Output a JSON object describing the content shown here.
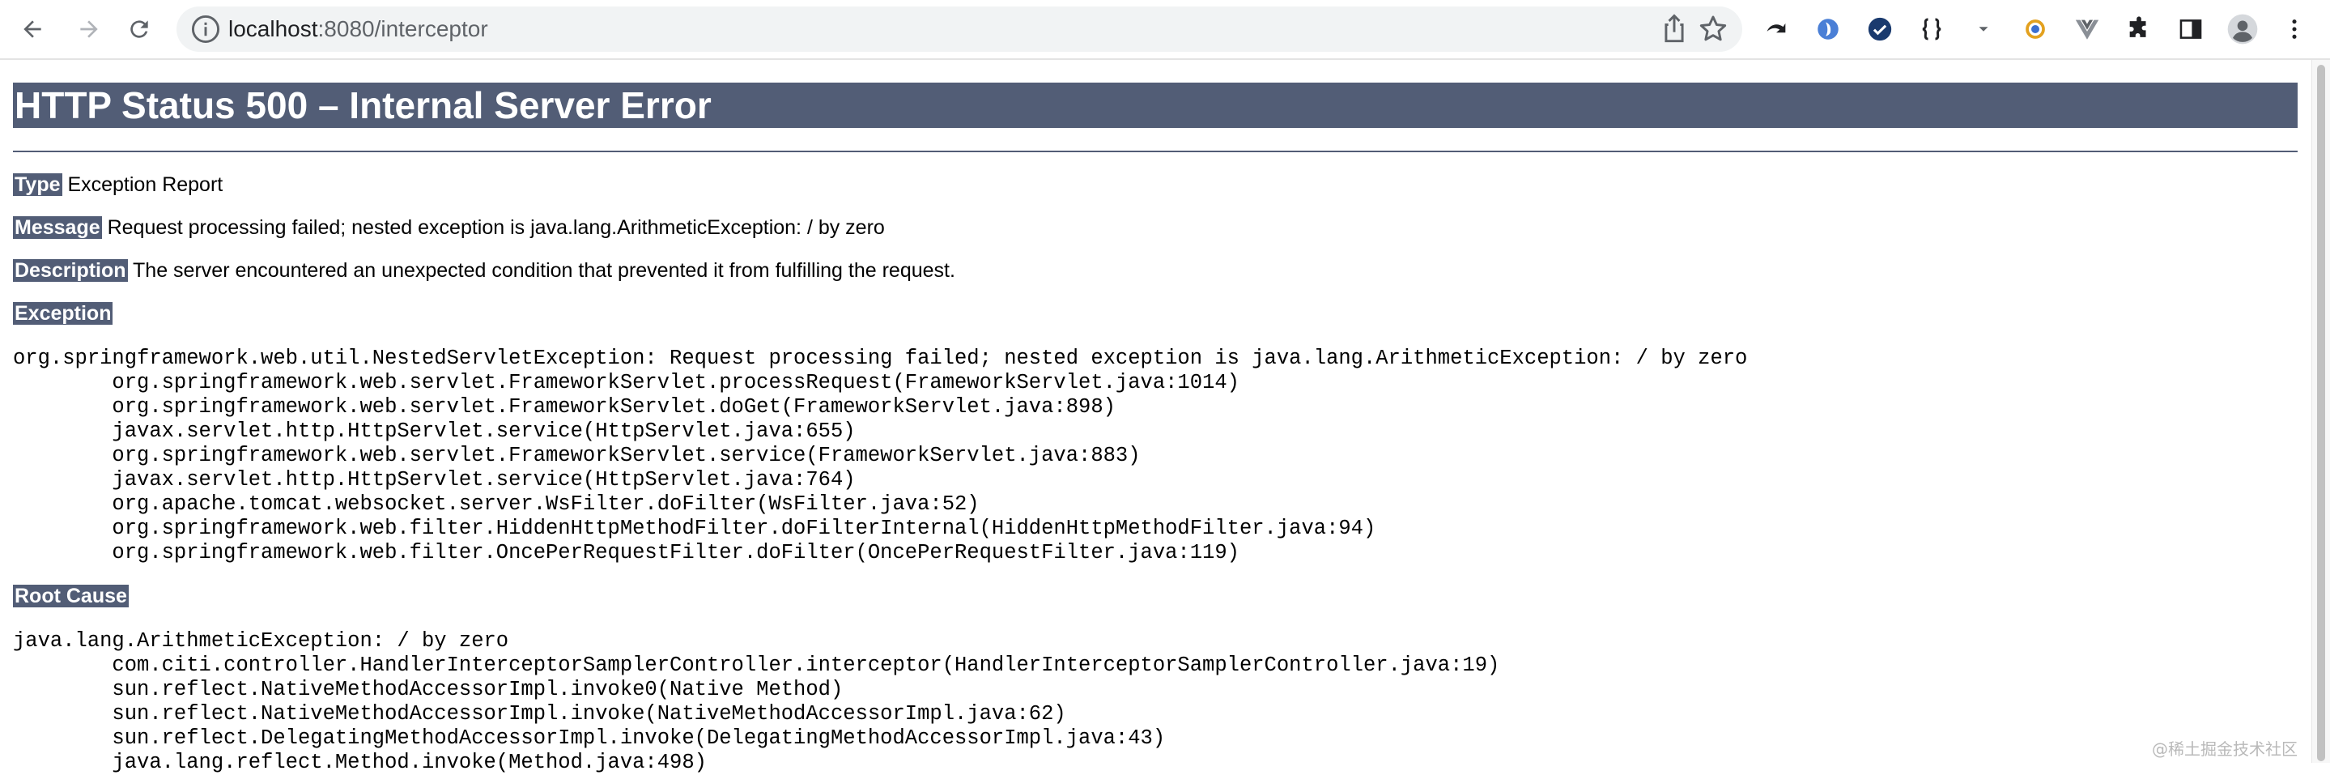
{
  "browser": {
    "url_host": "localhost",
    "url_path": ":8080/interceptor"
  },
  "error": {
    "title": "HTTP Status 500 – Internal Server Error",
    "type_label": "Type",
    "type_value": "Exception Report",
    "message_label": "Message",
    "message_value": "Request processing failed; nested exception is java.lang.ArithmeticException: / by zero",
    "description_label": "Description",
    "description_value": "The server encountered an unexpected condition that prevented it from fulfilling the request.",
    "exception_label": "Exception",
    "exception_trace": [
      "org.springframework.web.util.NestedServletException: Request processing failed; nested exception is java.lang.ArithmeticException: / by zero",
      "\torg.springframework.web.servlet.FrameworkServlet.processRequest(FrameworkServlet.java:1014)",
      "\torg.springframework.web.servlet.FrameworkServlet.doGet(FrameworkServlet.java:898)",
      "\tjavax.servlet.http.HttpServlet.service(HttpServlet.java:655)",
      "\torg.springframework.web.servlet.FrameworkServlet.service(FrameworkServlet.java:883)",
      "\tjavax.servlet.http.HttpServlet.service(HttpServlet.java:764)",
      "\torg.apache.tomcat.websocket.server.WsFilter.doFilter(WsFilter.java:52)",
      "\torg.springframework.web.filter.HiddenHttpMethodFilter.doFilterInternal(HiddenHttpMethodFilter.java:94)",
      "\torg.springframework.web.filter.OncePerRequestFilter.doFilter(OncePerRequestFilter.java:119)"
    ],
    "root_cause_label": "Root Cause",
    "root_cause_trace": [
      "java.lang.ArithmeticException: / by zero",
      "\tcom.citi.controller.HandlerInterceptorSamplerController.interceptor(HandlerInterceptorSamplerController.java:19)",
      "\tsun.reflect.NativeMethodAccessorImpl.invoke0(Native Method)",
      "\tsun.reflect.NativeMethodAccessorImpl.invoke(NativeMethodAccessorImpl.java:62)",
      "\tsun.reflect.DelegatingMethodAccessorImpl.invoke(DelegatingMethodAccessorImpl.java:43)",
      "\tjava.lang.reflect.Method.invoke(Method.java:498)"
    ]
  },
  "watermark": "@稀土掘金技术社区",
  "icons": {
    "toolbar_left": [
      "back-arrow-icon",
      "forward-arrow-icon",
      "reload-icon"
    ],
    "omnibox": [
      "info-icon",
      "share-icon",
      "bookmark-star-icon"
    ],
    "extensions": [
      "extension-back-icon",
      "extension-blue-icon",
      "extension-check-icon",
      "json-braces-icon",
      "dropdown-caret-icon",
      "extension-ring-icon",
      "vue-devtools-icon",
      "puzzle-piece-icon",
      "side-panel-icon",
      "profile-avatar-icon",
      "kebab-menu-icon"
    ]
  },
  "colors": {
    "tomcat_header": "#525d76",
    "text": "#000000",
    "url_path": "#5f6368"
  }
}
